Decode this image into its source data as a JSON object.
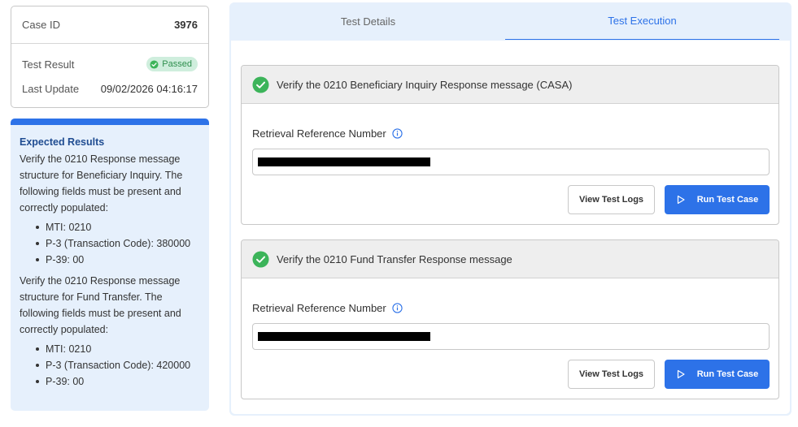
{
  "case": {
    "id_label": "Case ID",
    "id_value": "3976",
    "result_label": "Test Result",
    "result_badge": "Passed",
    "update_label": "Last Update",
    "update_value": "09/02/2026 04:16:17"
  },
  "expected": {
    "title": "Expected Results",
    "sections": [
      {
        "text": "Verify the 0210 Response message structure for Beneficiary Inquiry. The following fields must be present and correctly populated:",
        "items": [
          "MTI: 0210",
          "P-3 (Transaction Code): 380000",
          "P-39: 00"
        ]
      },
      {
        "text": "Verify the 0210 Response message structure for Fund Transfer. The following fields must be present and correctly populated:",
        "items": [
          "MTI: 0210",
          "P-3 (Transaction Code): 420000",
          "P-39: 00"
        ]
      }
    ]
  },
  "tabs": [
    "Test Details",
    "Test Execution"
  ],
  "active_tab": "Test Execution",
  "tests": [
    {
      "title": "Verify the 0210 Beneficiary Inquiry Response message (CASA)",
      "field_label": "Retrieval Reference Number",
      "logs_button": "View Test Logs",
      "run_button": "Run Test Case"
    },
    {
      "title": "Verify the 0210 Fund Transfer Response message",
      "field_label": "Retrieval Reference Number",
      "logs_button": "View Test Logs",
      "run_button": "Run Test Case"
    }
  ],
  "colors": {
    "accent": "#2d72e8",
    "success": "#3cb45a",
    "panel_bg": "#e6f0fc"
  },
  "icons": {
    "check": "check-circle-icon",
    "info": "info-icon",
    "play": "play-icon"
  }
}
